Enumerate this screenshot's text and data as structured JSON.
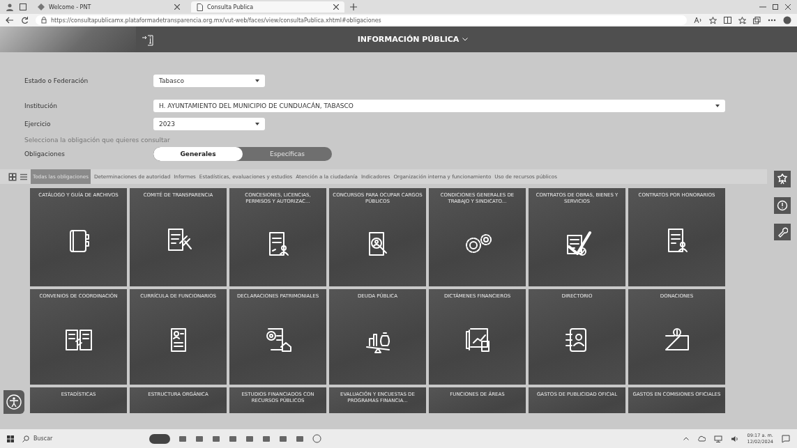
{
  "browser": {
    "tabs": [
      {
        "title": "Welcome - PNT",
        "selected": false
      },
      {
        "title": "Consulta Publica",
        "selected": true
      }
    ],
    "url": "https://consultapublicamx.plataformadetransparencia.org.mx/vut-web/faces/view/consultaPublica.xhtml#obligaciones"
  },
  "header": {
    "title": "INFORMACIÓN PÚBLICA"
  },
  "form": {
    "fields": [
      {
        "label": "Estado o Federación",
        "value": "Tabasco"
      },
      {
        "label": "Institución",
        "value": "H. AYUNTAMIENTO DEL MUNICIPIO DE CUNDUACÁN, TABASCO"
      },
      {
        "label": "Ejercicio",
        "value": "2023"
      }
    ],
    "hint": "Selecciona la obligación que quieres consultar",
    "obligaciones": {
      "label": "Obligaciones",
      "options": [
        {
          "label": "Generales",
          "selected": true
        },
        {
          "label": "Específicas",
          "selected": false
        }
      ]
    }
  },
  "categories": [
    {
      "label": "Todas las obligaciones",
      "selected": true
    },
    {
      "label": "Determinaciones de autoridad",
      "selected": false
    },
    {
      "label": "Informes",
      "selected": false
    },
    {
      "label": "Estadísticas, evaluaciones y estudios",
      "selected": false
    },
    {
      "label": "Atención a la ciudadanía",
      "selected": false
    },
    {
      "label": "Indicadores",
      "selected": false
    },
    {
      "label": "Organización interna y funcionamiento",
      "selected": false
    },
    {
      "label": "Uso de recursos públicos",
      "selected": false
    }
  ],
  "tiles": [
    {
      "title": "CATÁLOGO Y GUÍA DE ARCHIVOS"
    },
    {
      "title": "COMITÉ DE TRANSPARENCIA"
    },
    {
      "title": "CONCESIONES, LICENCIAS, PERMISOS Y AUTORIZAC..."
    },
    {
      "title": "CONCURSOS PARA OCUPAR CARGOS PÚBLICOS"
    },
    {
      "title": "CONDICIONES GENERALES DE TRABAJO Y SINDICATO..."
    },
    {
      "title": "CONTRATOS DE OBRAS, BIENES Y SERVICIOS"
    },
    {
      "title": "CONTRATOS POR HONORARIOS"
    },
    {
      "title": "CONVENIOS DE COORDINACIÓN"
    },
    {
      "title": "CURRÍCULA DE FUNCIONARIOS"
    },
    {
      "title": "DECLARACIONES PATRIMONIALES"
    },
    {
      "title": "DEUDA PÚBLICA"
    },
    {
      "title": "DICTÁMENES FINANCIEROS"
    },
    {
      "title": "DIRECTORIO"
    },
    {
      "title": "DONACIONES"
    },
    {
      "title": "ESTADÍSTICAS"
    },
    {
      "title": "ESTRUCTURA ORGÁNICA"
    },
    {
      "title": "ESTUDIOS FINANCIADOS CON RECURSOS PÚBLICOS"
    },
    {
      "title": "EVALUACIÓN Y ENCUESTAS DE PROGRAMAS FINANCIA..."
    },
    {
      "title": "FUNCIONES DE ÁREAS"
    },
    {
      "title": "GASTOS DE PUBLICIDAD OFICIAL"
    },
    {
      "title": "GASTOS EN COMISIONES OFICIALES"
    }
  ],
  "taskbar": {
    "search_placeholder": "Buscar",
    "time": "09:17 a. m.",
    "date": "12/02/2024"
  }
}
